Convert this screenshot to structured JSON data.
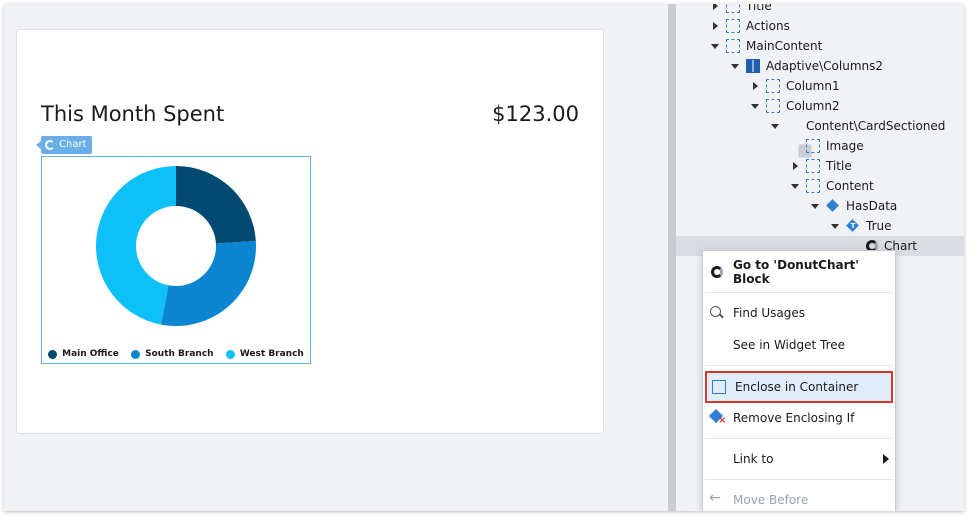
{
  "card": {
    "title": "This Month Spent",
    "amount": "$123.00",
    "chart_tag": "Chart"
  },
  "chart_data": {
    "type": "pie",
    "categories": [
      "Main Office",
      "South Branch",
      "West Branch"
    ],
    "values": [
      24,
      29,
      47
    ],
    "colors": [
      "#034a73",
      "#0a86d2",
      "#0dc0f7"
    ],
    "donut": true
  },
  "legend": {
    "items": [
      {
        "label": "Main Office",
        "color": "#034a73"
      },
      {
        "label": "South Branch",
        "color": "#0a86d2"
      },
      {
        "label": "West Branch",
        "color": "#0dc0f7"
      }
    ]
  },
  "tree": {
    "rows": [
      {
        "label": "Title",
        "icon": "container-icon",
        "expand": "right",
        "indent": 0
      },
      {
        "label": "Actions",
        "icon": "container-icon",
        "expand": "right",
        "indent": 0
      },
      {
        "label": "MainContent",
        "icon": "container-icon",
        "expand": "down",
        "indent": 0
      },
      {
        "label": "Adaptive\\Columns2",
        "icon": "columns-icon",
        "expand": "down",
        "indent": 1
      },
      {
        "label": "Column1",
        "icon": "container-icon",
        "expand": "right",
        "indent": 2
      },
      {
        "label": "Column2",
        "icon": "container-icon",
        "expand": "down",
        "indent": 2
      },
      {
        "label": "Content\\CardSectioned",
        "icon": "card-icon",
        "expand": "down",
        "indent": 3
      },
      {
        "label": "Image",
        "icon": "container-icon",
        "expand": "none",
        "indent": 4
      },
      {
        "label": "Title",
        "icon": "container-icon",
        "expand": "right",
        "indent": 4
      },
      {
        "label": "Content",
        "icon": "container-icon",
        "expand": "down",
        "indent": 4
      },
      {
        "label": "HasData",
        "icon": "if-icon",
        "expand": "down",
        "indent": 5
      },
      {
        "label": "True",
        "icon": "branch-icon",
        "expand": "down",
        "indent": 6
      },
      {
        "label": "Chart",
        "icon": "donut-chart-icon",
        "expand": "none",
        "indent": 7
      }
    ]
  },
  "menu": {
    "goto_block": "Go to 'DonutChart' Block",
    "find_usages": "Find Usages",
    "see_in_tree": "See in Widget Tree",
    "enclose_container": "Enclose in Container",
    "remove_enclosing_if": "Remove Enclosing If",
    "link_to": "Link to",
    "move_before": "Move Before"
  }
}
